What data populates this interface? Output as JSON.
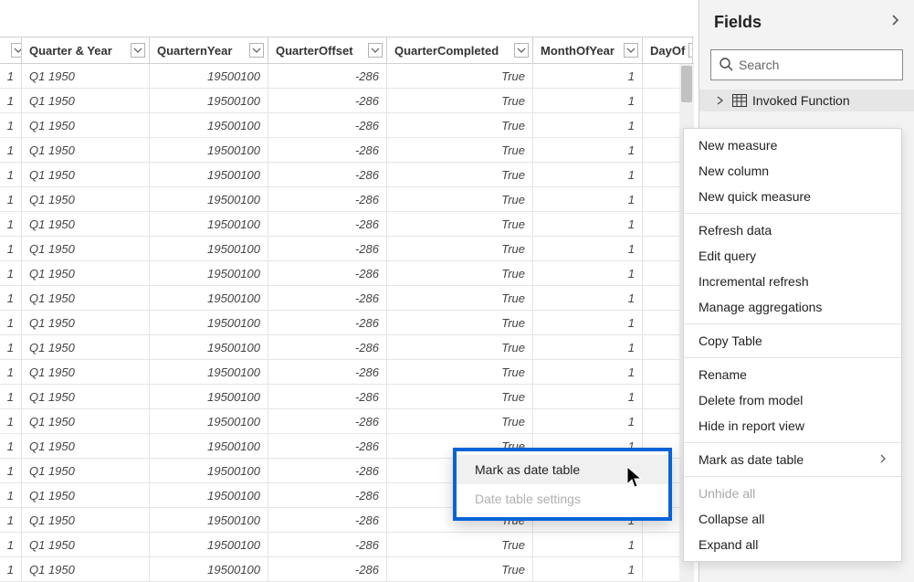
{
  "table": {
    "columns": [
      {
        "label": "",
        "width_class": "col0",
        "align": "right"
      },
      {
        "label": "Quarter & Year",
        "width_class": "col1",
        "align": "left"
      },
      {
        "label": "QuarternYear",
        "width_class": "col2",
        "align": "right"
      },
      {
        "label": "QuarterOffset",
        "width_class": "col3",
        "align": "right"
      },
      {
        "label": "QuarterCompleted",
        "width_class": "col4",
        "align": "right"
      },
      {
        "label": "MonthOfYear",
        "width_class": "col5",
        "align": "right"
      },
      {
        "label": "DayOf",
        "width_class": "col6",
        "align": "right"
      }
    ],
    "row_template": {
      "c0": "1",
      "c1": "Q1 1950",
      "c2": "19500100",
      "c3": "-286",
      "c4": "True",
      "c5": "1",
      "c6": ""
    },
    "visible_row_count": 21
  },
  "fields_panel": {
    "title": "Fields",
    "search_placeholder": "Search",
    "items": [
      {
        "label": "Invoked Function"
      }
    ]
  },
  "context_menu": {
    "items": [
      {
        "label": "New measure",
        "type": "item"
      },
      {
        "label": "New column",
        "type": "item"
      },
      {
        "label": "New quick measure",
        "type": "item"
      },
      {
        "type": "sep"
      },
      {
        "label": "Refresh data",
        "type": "item"
      },
      {
        "label": "Edit query",
        "type": "item"
      },
      {
        "label": "Incremental refresh",
        "type": "item"
      },
      {
        "label": "Manage aggregations",
        "type": "item"
      },
      {
        "type": "sep"
      },
      {
        "label": "Copy Table",
        "type": "item"
      },
      {
        "type": "sep"
      },
      {
        "label": "Rename",
        "type": "item"
      },
      {
        "label": "Delete from model",
        "type": "item"
      },
      {
        "label": "Hide in report view",
        "type": "item"
      },
      {
        "type": "sep"
      },
      {
        "label": "Mark as date table",
        "type": "item",
        "has_submenu": true
      },
      {
        "type": "sep"
      },
      {
        "label": "Unhide all",
        "type": "item",
        "disabled": true
      },
      {
        "label": "Collapse all",
        "type": "item"
      },
      {
        "label": "Expand all",
        "type": "item"
      }
    ]
  },
  "submenu": {
    "items": [
      {
        "label": "Mark as date table",
        "hover": true
      },
      {
        "label": "Date table settings",
        "disabled": true
      }
    ]
  }
}
